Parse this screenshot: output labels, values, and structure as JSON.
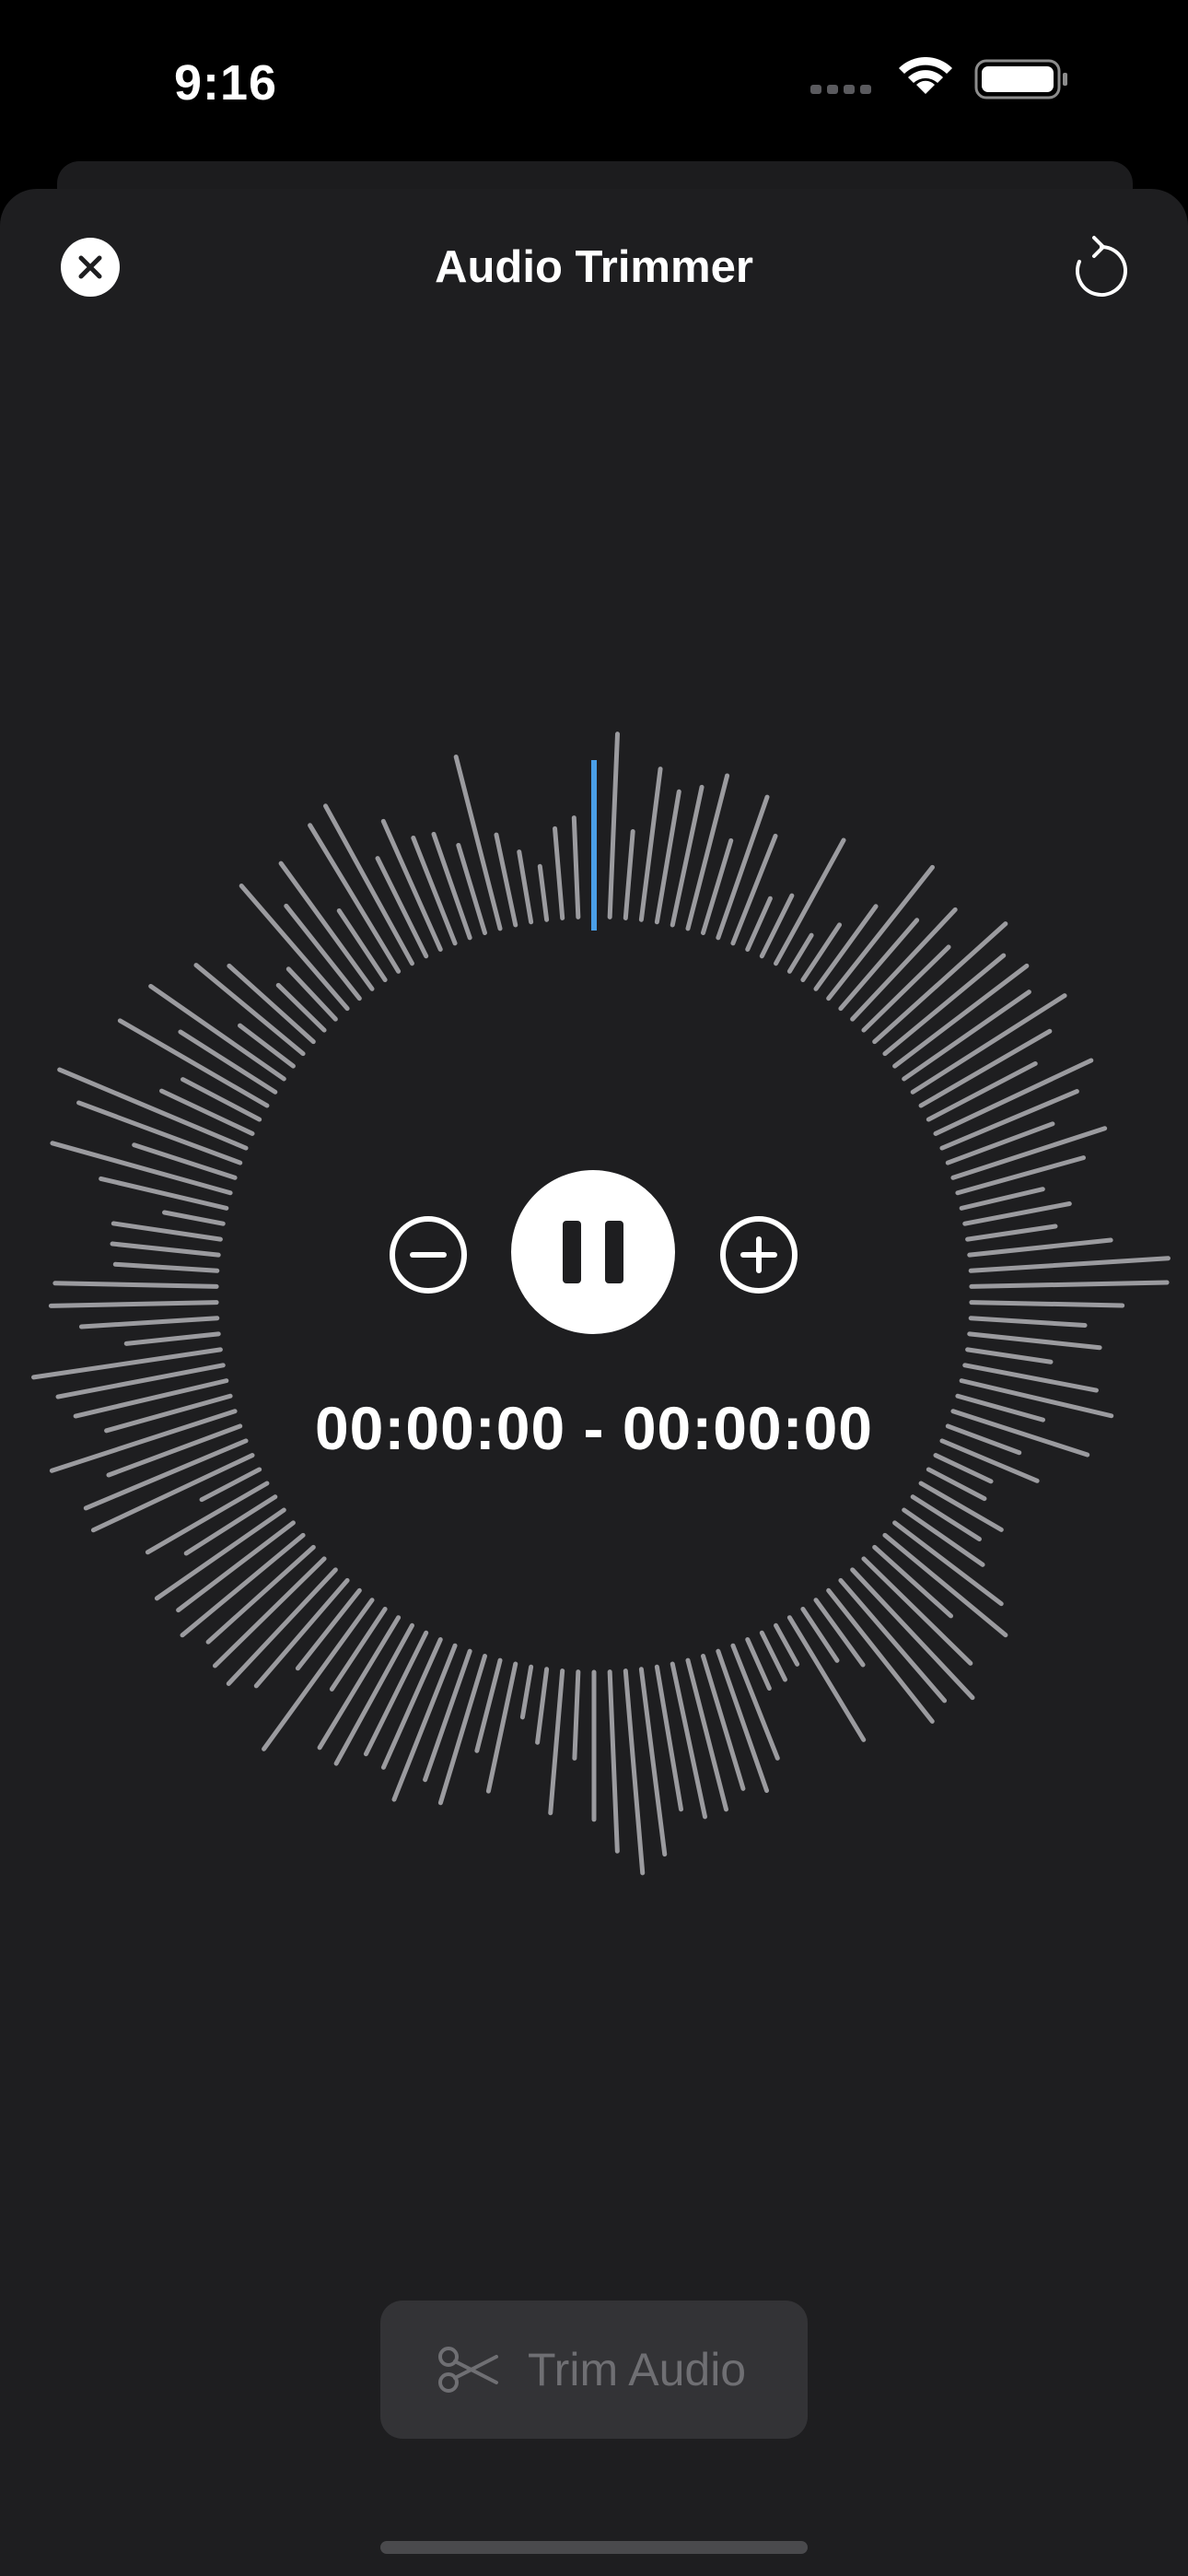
{
  "status_bar": {
    "time": "9:16",
    "icons": [
      "cellular-signal-icon",
      "wifi-icon",
      "battery-icon"
    ]
  },
  "header": {
    "title": "Audio Trimmer",
    "close_icon": "close-icon",
    "reset_icon": "refresh-icon"
  },
  "player": {
    "minus_icon": "minus-circle-icon",
    "play_state_icon": "pause-icon",
    "plus_icon": "plus-circle-icon",
    "time_range": "00:00:00 - 00:00:00"
  },
  "trim_button": {
    "label": "Trim Audio",
    "icon": "scissors-icon",
    "state": "disabled"
  },
  "colors": {
    "background": "#000000",
    "sheet": "#1e1e20",
    "waveform_bar": "#9b9b9f",
    "playhead": "#4a9fe8",
    "button_disabled": "#333336",
    "label_disabled": "#6f6f73"
  }
}
